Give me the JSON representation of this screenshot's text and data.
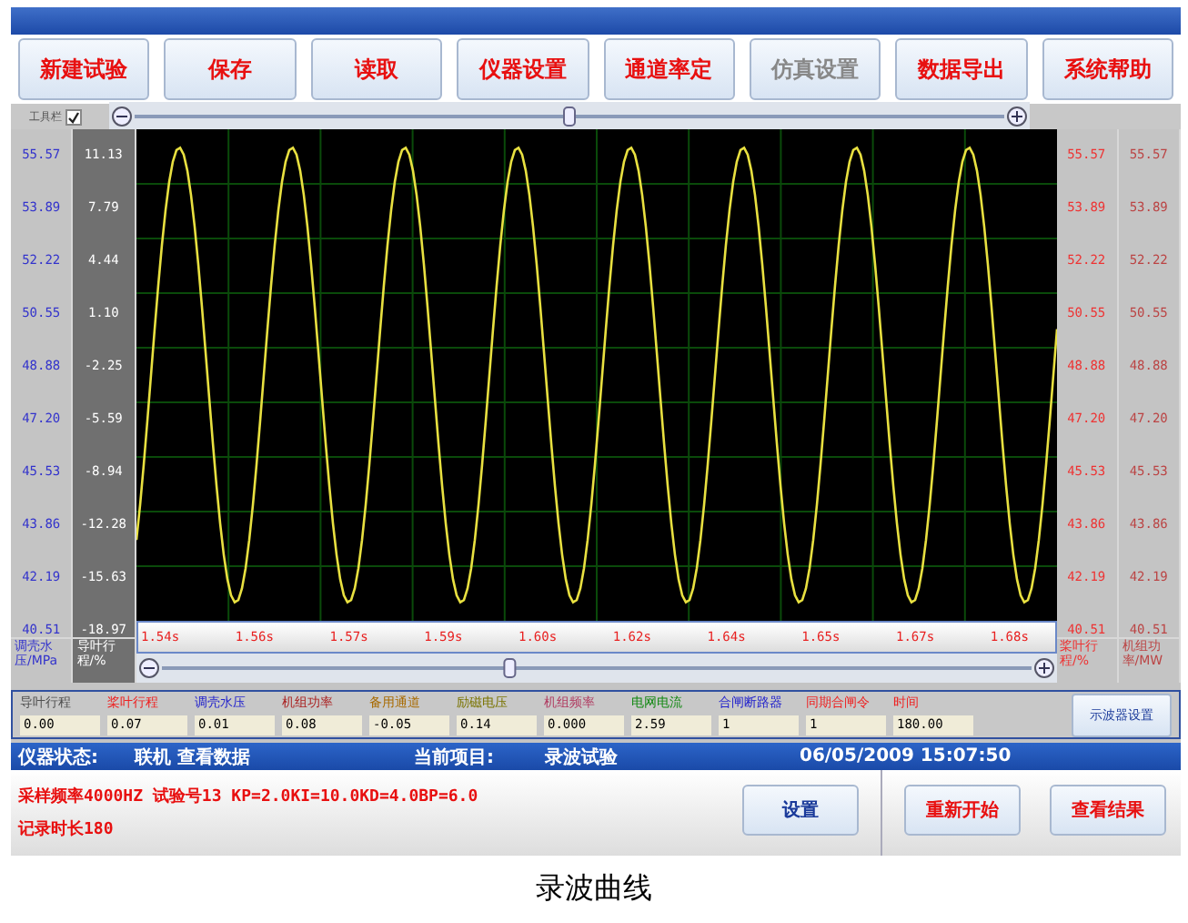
{
  "toolbar": [
    {
      "label": "新建试验",
      "disabled": false
    },
    {
      "label": "保存",
      "disabled": false
    },
    {
      "label": "读取",
      "disabled": false
    },
    {
      "label": "仪器设置",
      "disabled": false
    },
    {
      "label": "通道率定",
      "disabled": false
    },
    {
      "label": "仿真设置",
      "disabled": true
    },
    {
      "label": "数据导出",
      "disabled": false
    },
    {
      "label": "系统帮助",
      "disabled": false
    }
  ],
  "toolbar_toggle": {
    "label": "工具栏",
    "checked": true
  },
  "top_slider": {
    "level": 0.5
  },
  "bottom_slider": {
    "level": 0.4
  },
  "left_axes": [
    {
      "color": "#3333cc",
      "ticks": [
        "55.57",
        "53.89",
        "52.22",
        "50.55",
        "48.88",
        "47.20",
        "45.53",
        "43.86",
        "42.19",
        "40.51"
      ],
      "unit": "调壳水压/MPa"
    },
    {
      "color": "#ffffff",
      "ticks": [
        "11.13",
        "7.79",
        "4.44",
        "1.10",
        "-2.25",
        "-5.59",
        "-8.94",
        "-12.28",
        "-15.63",
        "-18.97"
      ],
      "unit": "导叶行程/%"
    }
  ],
  "right_axes": [
    {
      "color": "#ee3333",
      "ticks": [
        "55.57",
        "53.89",
        "52.22",
        "50.55",
        "48.88",
        "47.20",
        "45.53",
        "43.86",
        "42.19",
        "40.51"
      ],
      "unit": "桨叶行程/%"
    },
    {
      "color": "#bb4444",
      "ticks": [
        "55.57",
        "53.89",
        "52.22",
        "50.55",
        "48.88",
        "47.20",
        "45.53",
        "43.86",
        "42.19",
        "40.51"
      ],
      "unit": "机组功率/MW"
    }
  ],
  "time_ticks": [
    "1.54s",
    "1.56s",
    "1.57s",
    "1.59s",
    "1.60s",
    "1.62s",
    "1.64s",
    "1.65s",
    "1.67s",
    "1.68s"
  ],
  "channels": [
    {
      "name": "导叶行程",
      "color": "#505050",
      "value": "0.00"
    },
    {
      "name": "桨叶行程",
      "color": "#ee2222",
      "value": "0.07"
    },
    {
      "name": "调壳水压",
      "color": "#2222cc",
      "value": "0.01"
    },
    {
      "name": "机组功率",
      "color": "#aa2222",
      "value": "0.08"
    },
    {
      "name": "备用通道",
      "color": "#a86a00",
      "value": "-0.05"
    },
    {
      "name": "励磁电压",
      "color": "#7a7400",
      "value": "0.14"
    },
    {
      "name": "机组频率",
      "color": "#b03a60",
      "value": "0.000"
    },
    {
      "name": "电网电流",
      "color": "#118811",
      "value": "2.59"
    },
    {
      "name": "合闸断路器",
      "color": "#2222cc",
      "value": "1"
    },
    {
      "name": "同期合闸令",
      "color": "#ee2222",
      "value": "1"
    },
    {
      "name": "时间",
      "color": "#ee2222",
      "value": "180.00"
    }
  ],
  "scope_settings_button": "示波器设置",
  "status_bar": {
    "state_label": "仪器状态:",
    "state": "联机 查看数据",
    "project_label": "当前项目:",
    "project": "录波试验",
    "datetime": "06/05/2009 15:07:50"
  },
  "info_lines": [
    "采样频率4000HZ 试验号13 KP=2.0KI=10.0KD=4.0BP=6.0",
    "记录时长180"
  ],
  "bottom_buttons": [
    "设置",
    "重新开始",
    "查看结果"
  ],
  "caption": "录波曲线"
}
